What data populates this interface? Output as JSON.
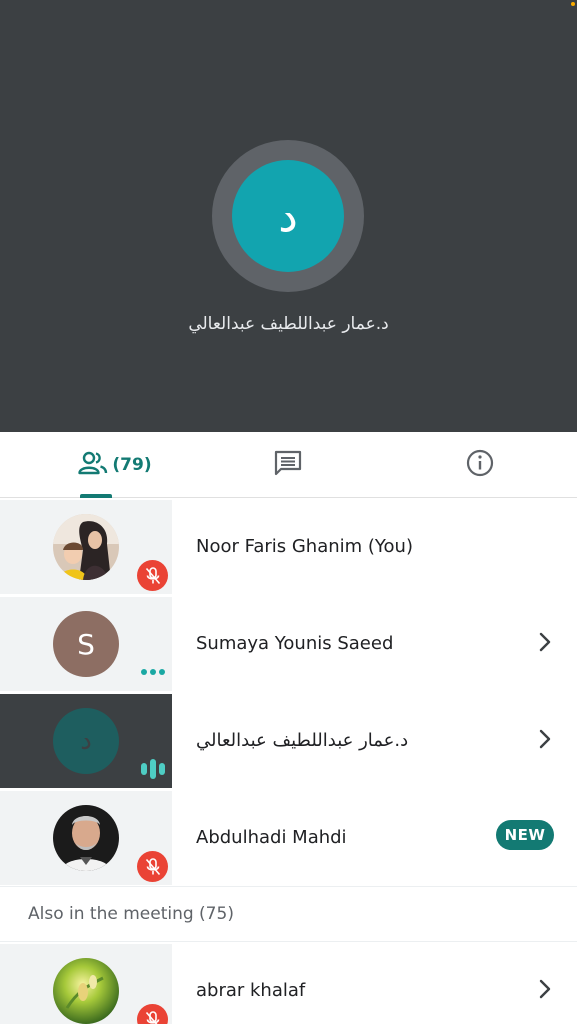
{
  "stage": {
    "speaker_initial": "د",
    "speaker_name": "د.عمار عبداللطيف عبدالعالي"
  },
  "tabs": {
    "people_count": "(79)",
    "active": "people"
  },
  "participants": [
    {
      "name": "Noor Faris Ghanim (You)",
      "status": "muted",
      "avatar": "photo"
    },
    {
      "name": "Sumaya Younis Saeed",
      "initial": "S",
      "status": "connecting",
      "has_chevron": true
    },
    {
      "name": "د.عمار عبداللطيف عبدالعالي",
      "initial": "د",
      "status": "speaking",
      "has_chevron": true,
      "active": true
    },
    {
      "name": "Abdulhadi Mahdi",
      "status": "muted",
      "badge": "NEW",
      "avatar": "photo"
    }
  ],
  "also_in_meeting": {
    "label": "Also in the meeting (75)",
    "participants": [
      {
        "name": "abrar khalaf",
        "status": "muted",
        "has_chevron": true,
        "avatar": "photo"
      }
    ]
  },
  "colors": {
    "accent": "#137a73",
    "stage_bg": "#3c4043",
    "speaker_avatar": "#12a4af",
    "mute_red": "#ea4335"
  },
  "icons": [
    "people-icon",
    "chat-icon",
    "info-icon",
    "chevron-right-icon",
    "mic-off-icon",
    "audio-level-icon",
    "more-dots-icon"
  ]
}
